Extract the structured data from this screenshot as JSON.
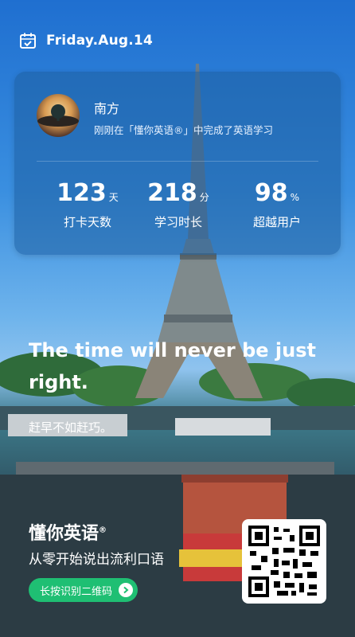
{
  "header": {
    "date": "Friday.Aug.14",
    "calendar_icon": "calendar-icon"
  },
  "profile": {
    "name": "南方",
    "subtitle": "刚刚在「懂你英语®」中完成了英语学习"
  },
  "stats": [
    {
      "value": "123",
      "unit": "天",
      "label": "打卡天数"
    },
    {
      "value": "218",
      "unit": "分",
      "label": "学习时长"
    },
    {
      "value": "98",
      "unit": "%",
      "label": "超越用户"
    }
  ],
  "quote": {
    "english": "The time will never be just right.",
    "chinese": "赶早不如赶巧。"
  },
  "footer": {
    "brand": "懂你英语",
    "brand_mark": "®",
    "slogan": "从零开始说出流利口语",
    "cta": "长按识别二维码",
    "cta_color": "#1fbf73"
  }
}
